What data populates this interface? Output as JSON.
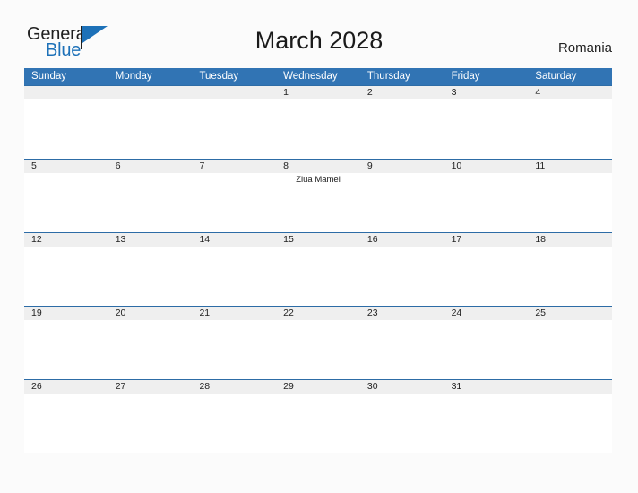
{
  "brand": {
    "name_part1": "General",
    "name_part2": "Blue",
    "flag_color": "#1d71b8"
  },
  "header": {
    "title": "March 2028",
    "region": "Romania"
  },
  "calendar": {
    "accent_color": "#3174b4",
    "date_band_color": "#efefef",
    "weekdays": [
      "Sunday",
      "Monday",
      "Tuesday",
      "Wednesday",
      "Thursday",
      "Friday",
      "Saturday"
    ],
    "weeks": [
      {
        "days": [
          {
            "num": "",
            "event": ""
          },
          {
            "num": "",
            "event": ""
          },
          {
            "num": "",
            "event": ""
          },
          {
            "num": "1",
            "event": ""
          },
          {
            "num": "2",
            "event": ""
          },
          {
            "num": "3",
            "event": ""
          },
          {
            "num": "4",
            "event": ""
          }
        ]
      },
      {
        "days": [
          {
            "num": "5",
            "event": ""
          },
          {
            "num": "6",
            "event": ""
          },
          {
            "num": "7",
            "event": ""
          },
          {
            "num": "8",
            "event": "Ziua Mamei"
          },
          {
            "num": "9",
            "event": ""
          },
          {
            "num": "10",
            "event": ""
          },
          {
            "num": "11",
            "event": ""
          }
        ]
      },
      {
        "days": [
          {
            "num": "12",
            "event": ""
          },
          {
            "num": "13",
            "event": ""
          },
          {
            "num": "14",
            "event": ""
          },
          {
            "num": "15",
            "event": ""
          },
          {
            "num": "16",
            "event": ""
          },
          {
            "num": "17",
            "event": ""
          },
          {
            "num": "18",
            "event": ""
          }
        ]
      },
      {
        "days": [
          {
            "num": "19",
            "event": ""
          },
          {
            "num": "20",
            "event": ""
          },
          {
            "num": "21",
            "event": ""
          },
          {
            "num": "22",
            "event": ""
          },
          {
            "num": "23",
            "event": ""
          },
          {
            "num": "24",
            "event": ""
          },
          {
            "num": "25",
            "event": ""
          }
        ]
      },
      {
        "days": [
          {
            "num": "26",
            "event": ""
          },
          {
            "num": "27",
            "event": ""
          },
          {
            "num": "28",
            "event": ""
          },
          {
            "num": "29",
            "event": ""
          },
          {
            "num": "30",
            "event": ""
          },
          {
            "num": "31",
            "event": ""
          },
          {
            "num": "",
            "event": ""
          }
        ]
      }
    ]
  }
}
